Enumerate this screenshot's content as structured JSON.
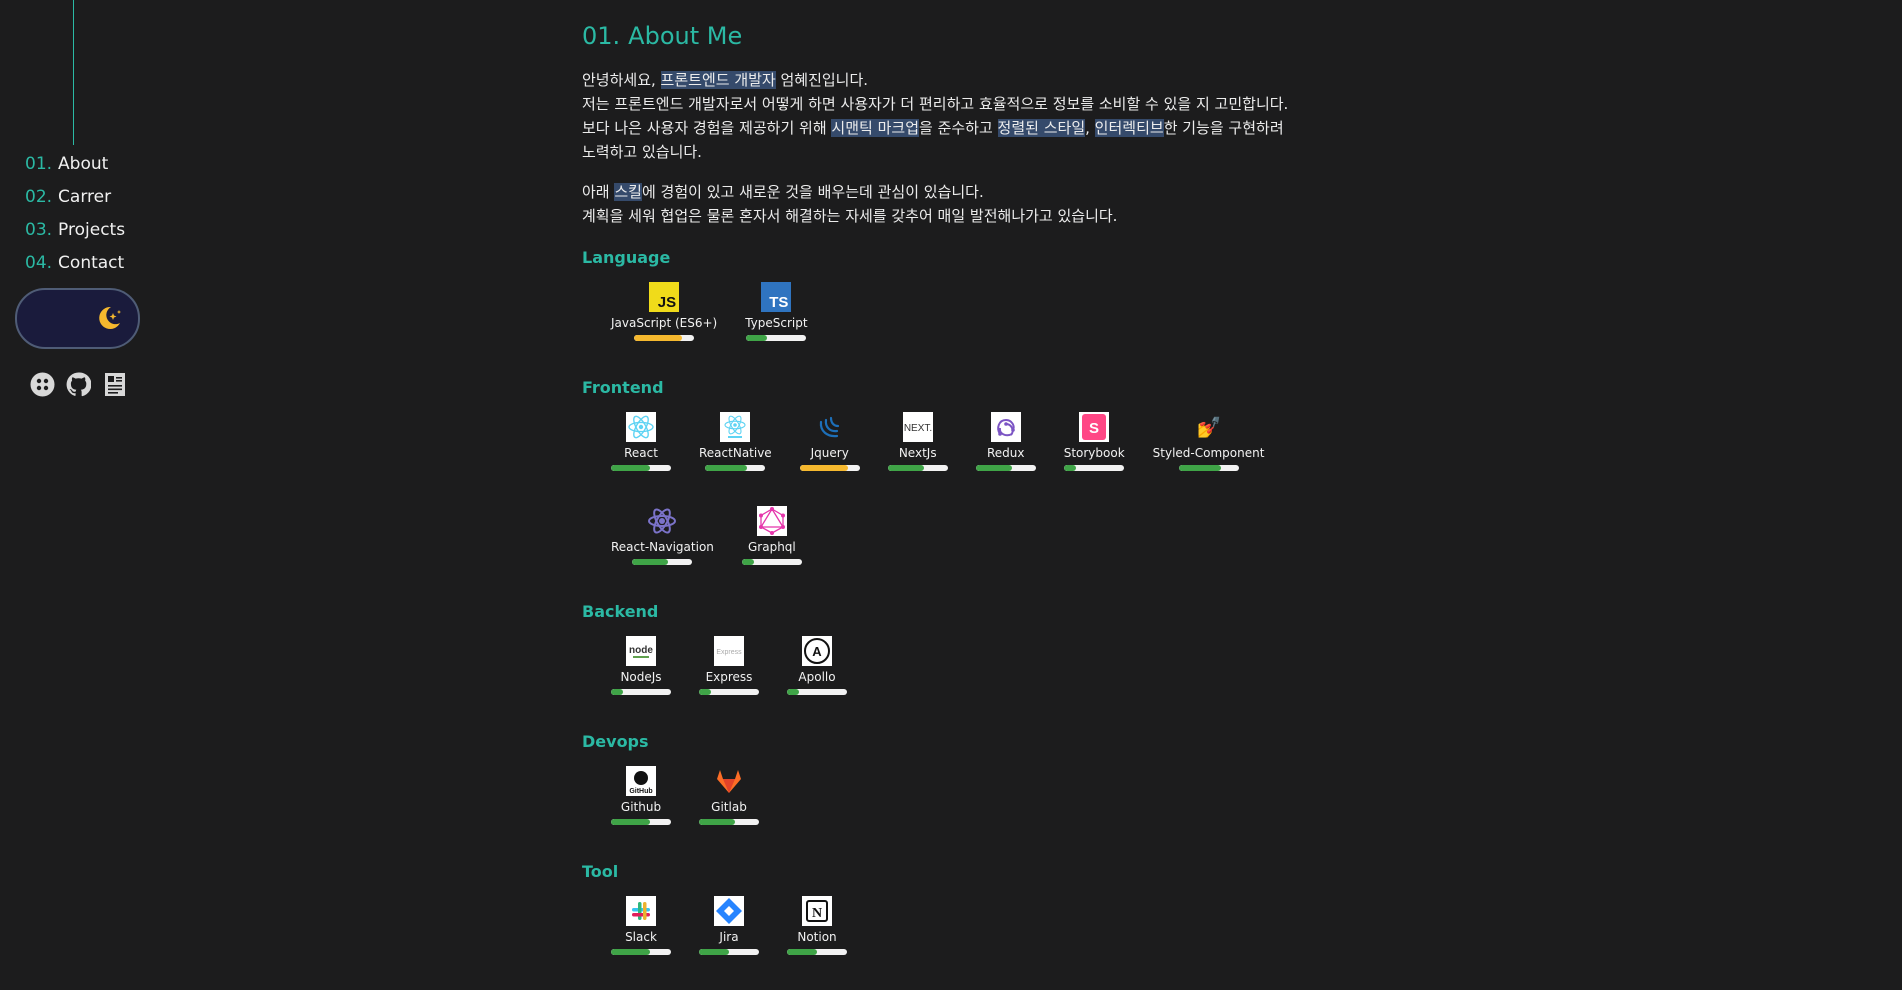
{
  "nav": [
    {
      "num": "01.",
      "label": "About"
    },
    {
      "num": "02.",
      "label": "Carrer"
    },
    {
      "num": "03.",
      "label": "Projects"
    },
    {
      "num": "04.",
      "label": "Contact"
    }
  ],
  "theme_toggle": {
    "icon": "moon-stars-icon"
  },
  "socials": [
    {
      "icon": "dots-icon"
    },
    {
      "icon": "github-icon"
    },
    {
      "icon": "resume-icon"
    }
  ],
  "about": {
    "num": "01.",
    "title": "About Me",
    "p1": {
      "l1_a": "안녕하세요, ",
      "l1_hl": "프론트엔드 개발자",
      "l1_b": " 엄혜진입니다.",
      "l2": "저는 프론트엔드 개발자로서 어떻게 하면 사용자가 더 편리하고 효율적으로 정보를 소비할 수 있을 지 고민합니다.",
      "l3_a": "보다 나은 사용자 경험을 제공하기 위해 ",
      "l3_hl1": "시맨틱 마크업",
      "l3_b": "을 준수하고 ",
      "l3_hl2": "정렬된 스타일",
      "l3_c": ", ",
      "l3_hl3": "인터렉티브",
      "l3_d": "한 기능을 구현하려",
      "l4": "노력하고 있습니다."
    },
    "p2": {
      "l1_a": "아래 ",
      "l1_hl": "스킬",
      "l1_b": "에 경험이 있고 새로운 것을 배우는데 관심이 있습니다.",
      "l2": "계획을 세워 협업은 물론 혼자서 해결하는 자세를 갖추어 매일 발전해나가고 있습니다."
    }
  },
  "skill_groups": [
    {
      "title": "Language",
      "skills": [
        {
          "name": "JavaScript (ES6+)",
          "icon": "javascript-icon",
          "level": 0.8,
          "color": "#f5b82e"
        },
        {
          "name": "TypeScript",
          "icon": "typescript-icon",
          "level": 0.35,
          "color": "#3fa447"
        }
      ]
    },
    {
      "title": "Frontend",
      "skills": [
        {
          "name": "React",
          "icon": "react-icon",
          "level": 0.65,
          "color": "#3fa447"
        },
        {
          "name": "ReactNative",
          "icon": "react-native-icon",
          "level": 0.7,
          "color": "#3fa447"
        },
        {
          "name": "Jquery",
          "icon": "jquery-icon",
          "level": 0.8,
          "color": "#f5b82e"
        },
        {
          "name": "NextJs",
          "icon": "nextjs-icon",
          "level": 0.6,
          "color": "#3fa447"
        },
        {
          "name": "Redux",
          "icon": "redux-icon",
          "level": 0.6,
          "color": "#3fa447"
        },
        {
          "name": "Storybook",
          "icon": "storybook-icon",
          "level": 0.2,
          "color": "#3fa447"
        },
        {
          "name": "Styled-Component",
          "icon": "styled-components-icon",
          "level": 0.7,
          "color": "#3fa447"
        },
        {
          "name": "React-Navigation",
          "icon": "react-navigation-icon",
          "level": 0.6,
          "color": "#3fa447"
        },
        {
          "name": "Graphql",
          "icon": "graphql-icon",
          "level": 0.2,
          "color": "#3fa447"
        }
      ]
    },
    {
      "title": "Backend",
      "skills": [
        {
          "name": "NodeJs",
          "icon": "nodejs-icon",
          "level": 0.2,
          "color": "#3fa447"
        },
        {
          "name": "Express",
          "icon": "express-icon",
          "level": 0.2,
          "color": "#3fa447"
        },
        {
          "name": "Apollo",
          "icon": "apollo-icon",
          "level": 0.2,
          "color": "#3fa447"
        }
      ]
    },
    {
      "title": "Devops",
      "skills": [
        {
          "name": "Github",
          "icon": "github-icon",
          "level": 0.65,
          "color": "#3fa447"
        },
        {
          "name": "Gitlab",
          "icon": "gitlab-icon",
          "level": 0.6,
          "color": "#3fa447"
        }
      ]
    },
    {
      "title": "Tool",
      "skills": [
        {
          "name": "Slack",
          "icon": "slack-icon",
          "level": 0.65,
          "color": "#3fa447"
        },
        {
          "name": "Jira",
          "icon": "jira-icon",
          "level": 0.5,
          "color": "#3fa447"
        },
        {
          "name": "Notion",
          "icon": "notion-icon",
          "level": 0.5,
          "color": "#3fa447"
        }
      ]
    }
  ]
}
